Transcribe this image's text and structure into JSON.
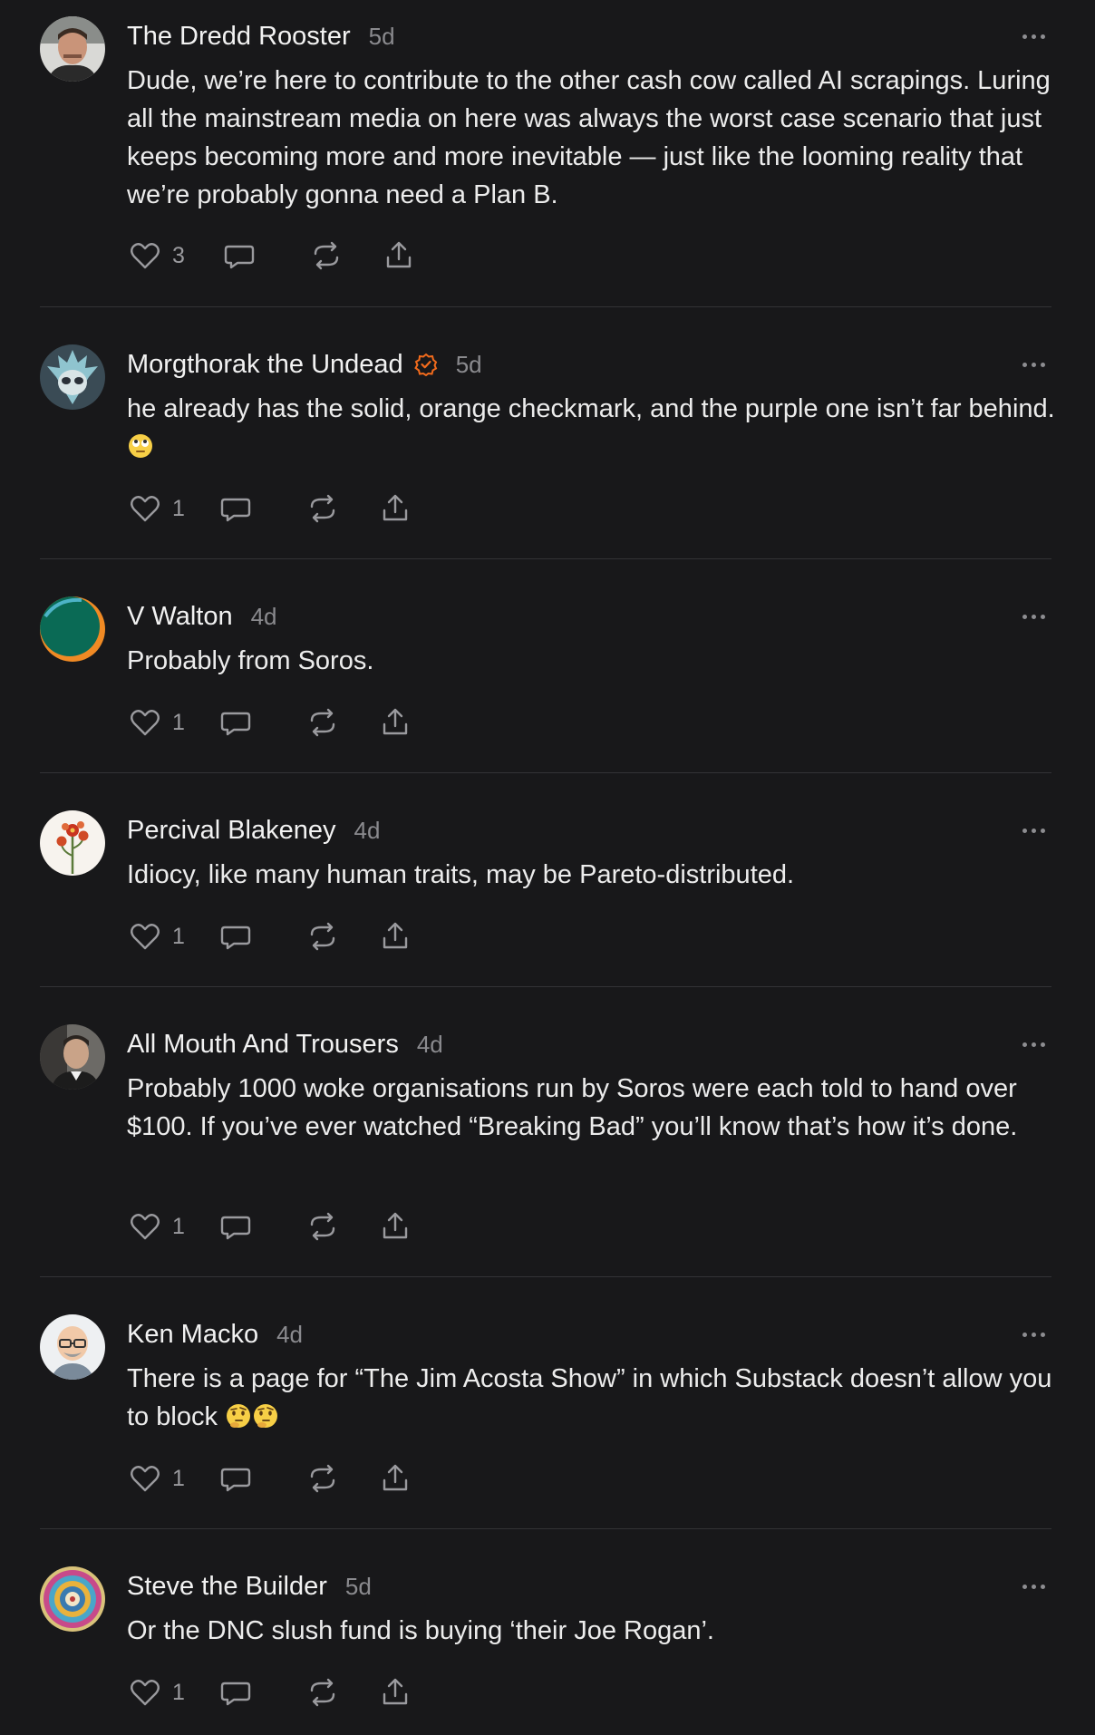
{
  "comments": [
    {
      "author": "The Dredd Rooster",
      "time": "5d",
      "verified": false,
      "avatar_icon": "photo-avatar-man-icon",
      "text": "Dude, we’re here to contribute to the other cash cow called AI scrapings. Luring all the mainstream media on here was always the worst case scenario that just keeps becoming more and more inevitable — just like the looming reality that we’re probably gonna need a Plan B.",
      "likes": "3"
    },
    {
      "author": "Morgthorak the Undead",
      "time": "5d",
      "verified": true,
      "avatar_icon": "alien-mask-avatar-icon",
      "text": "he already has the solid, orange checkmark, and the purple one isn’t far behind.",
      "emoji": "eye-roll-emoji-icon",
      "likes": "1"
    },
    {
      "author": "V Walton",
      "time": "4d",
      "verified": false,
      "avatar_icon": "green-orange-circle-avatar-icon",
      "text": "Probably from Soros.",
      "likes": "1"
    },
    {
      "author": "Percival Blakeney",
      "time": "4d",
      "verified": false,
      "avatar_icon": "red-flower-avatar-icon",
      "text": "Idiocy, like many human traits, may be Pareto-distributed.",
      "likes": "1"
    },
    {
      "author": "All Mouth And Trousers",
      "time": "4d",
      "verified": false,
      "avatar_icon": "photo-avatar-man-icon",
      "text": "Probably 1000 woke organisations run by Soros were each told to hand over $100. If you’ve ever watched “Breaking Bad” you’ll know that’s how it’s done.",
      "likes": "1"
    },
    {
      "author": "Ken Macko",
      "time": "4d",
      "verified": false,
      "avatar_icon": "cartoon-bald-man-avatar-icon",
      "text": "There is a page for “The Jim Acosta Show” in which Substack doesn’t allow you to block",
      "emoji": "thinking-face-emoji-icon",
      "likes": "1"
    },
    {
      "author": "Steve the Builder",
      "time": "5d",
      "verified": false,
      "avatar_icon": "mandala-avatar-icon",
      "text": "Or the DNC slush fund is buying ‘their Joe Rogan’.",
      "likes": "1"
    }
  ],
  "colors": {
    "background": "#18181a",
    "text": "#ececec",
    "muted": "#8a8a8e",
    "verified": "#f36b1c",
    "divider": "#333336"
  }
}
